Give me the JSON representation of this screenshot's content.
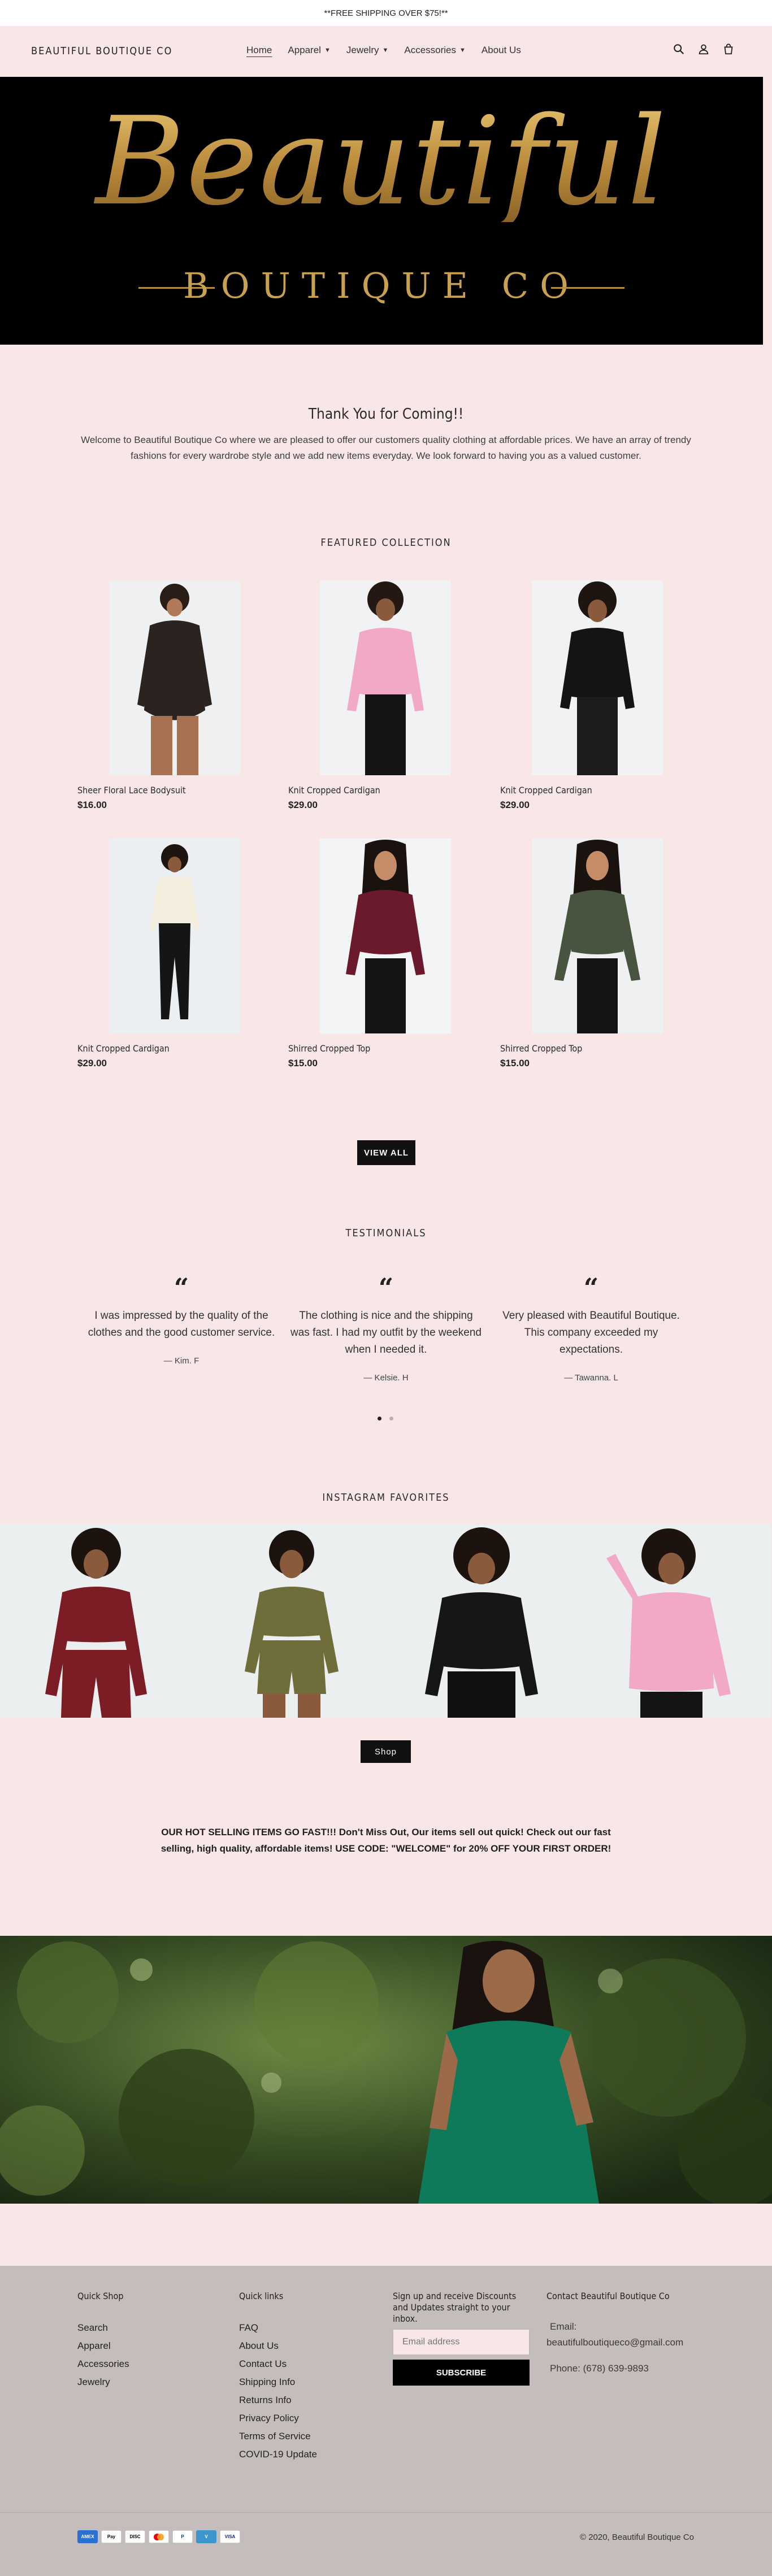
{
  "announcement": "**FREE SHIPPING OVER $75!**",
  "header": {
    "store_name": "BEAUTIFUL BOUTIQUE CO",
    "nav": [
      {
        "label": "Home"
      },
      {
        "label": "Apparel"
      },
      {
        "label": "Jewelry"
      },
      {
        "label": "Accessories"
      },
      {
        "label": "About Us"
      }
    ],
    "icons": [
      "search-icon",
      "account-icon",
      "cart-icon"
    ]
  },
  "hero": {
    "logo_script": "Beautiful",
    "logo_sub": "BOUTIQUE CO"
  },
  "welcome": {
    "title": "Thank You for Coming!!",
    "text": "Welcome to Beautiful Boutique Co where we are pleased to offer our customers quality clothing at affordable prices. We have an array of trendy fashions for every wardrobe style and we add new items everyday. We look forward to having you as a valued customer."
  },
  "featured": {
    "title": "FEATURED COLLECTION",
    "products": [
      {
        "name": "Sheer Floral Lace Bodysuit",
        "price": "$16.00",
        "garment": "#2a2320"
      },
      {
        "name": "Knit Cropped Cardigan",
        "price": "$29.00",
        "garment": "#f2a9c6"
      },
      {
        "name": "Knit Cropped Cardigan",
        "price": "$29.00",
        "garment": "#141414"
      },
      {
        "name": "Knit Cropped Cardigan",
        "price": "$29.00",
        "garment": "#f3eedd"
      },
      {
        "name": "Shirred Cropped Top",
        "price": "$15.00",
        "garment": "#6a1a2c"
      },
      {
        "name": "Shirred Cropped Top",
        "price": "$15.00",
        "garment": "#485440"
      }
    ],
    "view_all": "VIEW ALL"
  },
  "testimonials": {
    "title": "TESTIMONIALS",
    "items": [
      {
        "quote": "I was impressed by the quality of the clothes and the good customer service.",
        "author": "— Kim. F"
      },
      {
        "quote": "The clothing is nice and the shipping was fast. I had my outfit by the weekend when I needed it.",
        "author": "— Kelsie. H"
      },
      {
        "quote": "Very pleased with Beautiful Boutique. This company exceeded my expectations.",
        "author": "— Tawanna. L"
      }
    ]
  },
  "instagram": {
    "title": "INSTAGRAM FAVORITES",
    "tiles": [
      "#7c1c24",
      "#6f6e3a",
      "#161616",
      "#f2a9c6"
    ],
    "shop": "Shop"
  },
  "promo": "OUR HOT SELLING ITEMS GO FAST!!! Don't Miss Out, Our items sell out quick! Check out our fast selling, high quality, affordable items! USE CODE: \"WELCOME\" for 20% OFF YOUR FIRST ORDER!",
  "footer": {
    "quick_shop": {
      "title": "Quick Shop",
      "links": [
        "Search",
        "Apparel",
        "Accessories",
        "Jewelry"
      ]
    },
    "quick_links": {
      "title": "Quick links",
      "links": [
        "FAQ",
        "About Us",
        "Contact Us",
        "Shipping Info",
        "Returns Info",
        "Privacy Policy",
        "Terms of Service",
        "COVID-19 Update"
      ]
    },
    "newsletter": {
      "title": "Sign up and receive Discounts and Updates straight to your inbox.",
      "placeholder": "Email address",
      "button": "SUBSCRIBE"
    },
    "contact": {
      "title": "Contact Beautiful Boutique Co",
      "email_label": "Email:",
      "email": "beautifulboutiqueco@gmail.com",
      "phone": "Phone: (678) 639-9893"
    },
    "payments": [
      "AMEX",
      "Apple Pay",
      "Discover",
      "Mastercard",
      "PayPal",
      "Venmo",
      "VISA"
    ],
    "copyright": "© 2020, Beautiful Boutique Co"
  }
}
